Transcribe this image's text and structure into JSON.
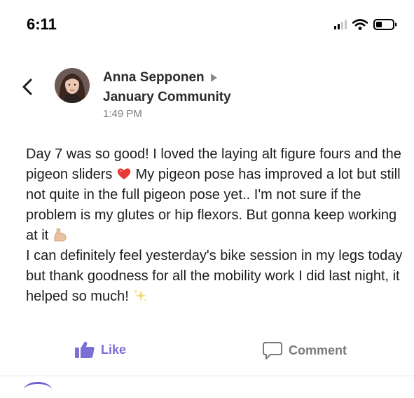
{
  "status_bar": {
    "time": "6:11"
  },
  "post": {
    "author": "Anna Sepponen",
    "community": "January Community",
    "timestamp": "1:49 PM",
    "body_segments": [
      "Day 7 was so good! I loved the laying alt figure fours and the pigeon sliders",
      "My pigeon pose has improved a lot but still not quite in the full pigeon pose yet.. I'm not sure if the problem is my glutes or hip flexors. But gonna keep working at it",
      "I can definitely feel yesterday's bike session in my legs today but thank goodness for all the mobility work I did last night, it helped so much!"
    ]
  },
  "actions": {
    "like_label": "Like",
    "comment_label": "Comment"
  },
  "colors": {
    "accent": "#7b6fd6",
    "muted": "#7a7a7a"
  },
  "icons": [
    "back-chevron-icon",
    "play-triangle-icon",
    "thumbs-up-icon",
    "comment-bubble-icon",
    "heart-emoji",
    "flexed-biceps-emoji",
    "sparkles-emoji"
  ]
}
